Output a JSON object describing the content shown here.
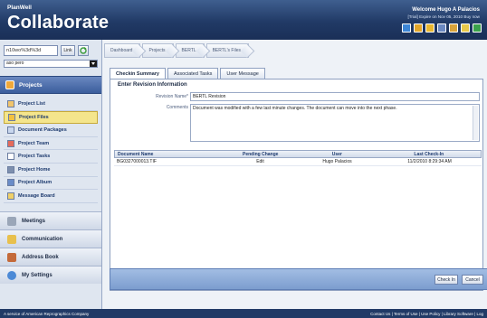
{
  "header": {
    "logo_small": "PlanWell",
    "logo_big": "Collaborate",
    "welcome": "Welcome Hugo A Palacios",
    "subwelcome": "[Trial] Expire on Nov 05, 2010 Buy now",
    "tool_icons": [
      "globe-icon",
      "help-icon",
      "print-icon",
      "close-icon",
      "export-icon",
      "lock-icon",
      "upload-icon"
    ]
  },
  "sidebar": {
    "search_value": "n10wo%3d%3d",
    "link_btn": "Link",
    "select_value": "aso pero",
    "projects_header": "Projects",
    "items": [
      {
        "label": "Project List",
        "active": false
      },
      {
        "label": "Project Files",
        "active": true
      },
      {
        "label": "Document Packages",
        "active": false
      },
      {
        "label": "Project Team",
        "active": false
      },
      {
        "label": "Project Tasks",
        "active": false
      },
      {
        "label": "Project Home",
        "active": false
      },
      {
        "label": "Project Album",
        "active": false
      },
      {
        "label": "Message Board",
        "active": false
      }
    ],
    "sections": [
      {
        "label": "Meetings",
        "icon": "meetings-icon"
      },
      {
        "label": "Communication",
        "icon": "communication-icon"
      },
      {
        "label": "Address Book",
        "icon": "address-book-icon"
      },
      {
        "label": "My Settings",
        "icon": "settings-icon"
      }
    ]
  },
  "breadcrumb": [
    "Dashboard",
    "Projects",
    "BERTL",
    "BERTL's Files"
  ],
  "tabs": [
    "Checkin Summary",
    "Associated Tasks",
    "User Message"
  ],
  "form": {
    "title": "Enter Revision Information",
    "revision_label": "Revision Name*",
    "revision_value": "BERTL Revision",
    "comments_label": "Comments",
    "comments_value": "Document was modified with a few last minute changes. The document can move into the next phase."
  },
  "table": {
    "headers": [
      "Document Name",
      "Pending Change",
      "User",
      "Last Check-In"
    ],
    "rows": [
      [
        "BG0327000013.TIF",
        "Edit",
        "Hugo Palacios",
        "11/2/2010 8:29:34 AM"
      ]
    ]
  },
  "buttons": {
    "checkin": "Check In",
    "cancel": "Cancel"
  },
  "footer": {
    "left": "A service of American Reprographics Company",
    "right": "Contact Us | Terms of Use | Use Policy | Library Software | Log"
  },
  "colors": {
    "brand": "#213a66",
    "accent": "#f4e58c"
  }
}
